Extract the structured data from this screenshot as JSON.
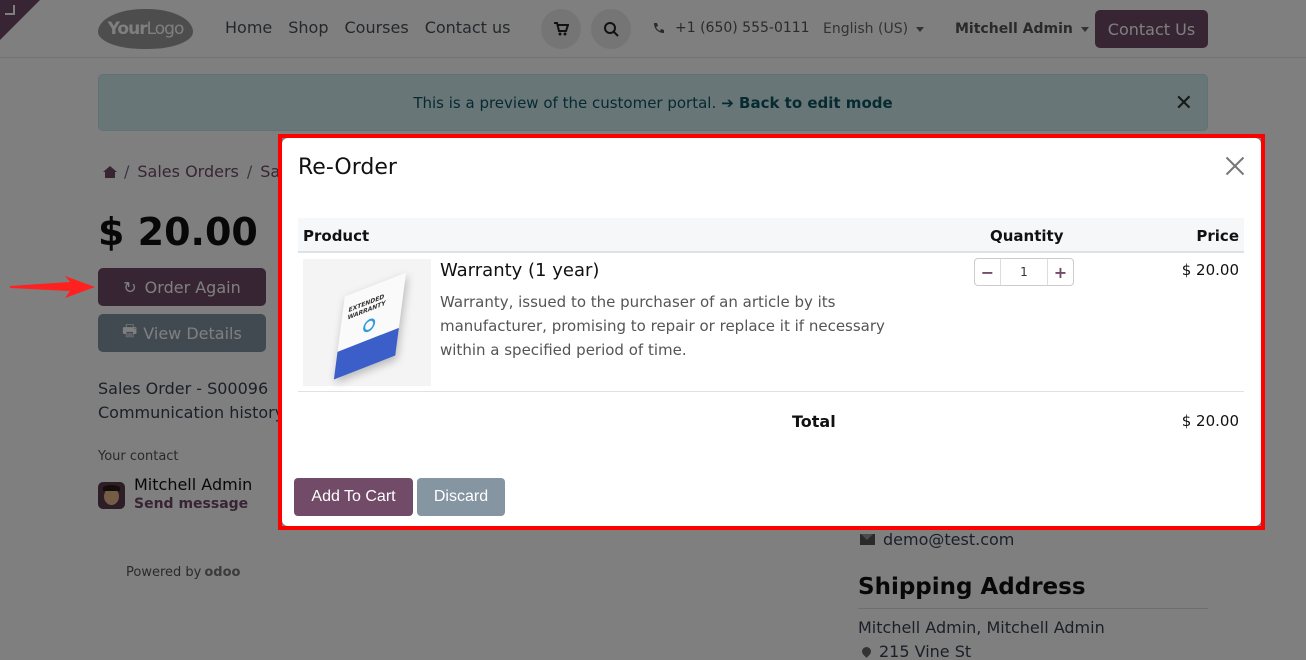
{
  "navbar": {
    "logo_bold": "Your",
    "logo_light": "Logo",
    "links": [
      "Home",
      "Shop",
      "Courses",
      "Contact us"
    ],
    "icons": [
      "cart-icon",
      "search-icon"
    ],
    "phone": "+1 (650) 555-0111",
    "language": "English (US)",
    "user": "Mitchell Admin",
    "contact_button": "Contact Us"
  },
  "alert": {
    "text": "This is a preview of the customer portal.",
    "link": "➔ Back to edit mode"
  },
  "breadcrumb": [
    "Sales Orders",
    "Sale"
  ],
  "order": {
    "amount": "$ 20.00",
    "order_again": "Order Again",
    "view_details": "View Details",
    "reference": "Sales Order - S00096",
    "communication": "Communication history",
    "contact_label": "Your contact",
    "contact_name": "Mitchell Admin",
    "send_message": "Send message",
    "powered_by": "Powered by",
    "powered_brand": "odoo",
    "email": "demo@test.com",
    "shipping_title": "Shipping Address",
    "shipping_name": "Mitchell Admin, Mitchell Admin",
    "shipping_street": "215 Vine St"
  },
  "modal": {
    "title": "Re-Order",
    "columns": {
      "product": "Product",
      "quantity": "Quantity",
      "price": "Price"
    },
    "lines": [
      {
        "name": "Warranty (1 year)",
        "description": "Warranty, issued to the purchaser of an article by its manufacturer, promising to repair or replace it if necessary within a specified period of time.",
        "image_label": "EXTENDED WARRANTY",
        "quantity": "1",
        "price": "$ 20.00"
      }
    ],
    "total_label": "Total",
    "total_value": "$ 20.00",
    "add_to_cart": "Add To Cart",
    "discard": "Discard"
  },
  "colors": {
    "brand": "#714B67",
    "secondary": "#8595a2",
    "highlight": "#ff0000",
    "alert_bg": "#d1ecf1"
  }
}
